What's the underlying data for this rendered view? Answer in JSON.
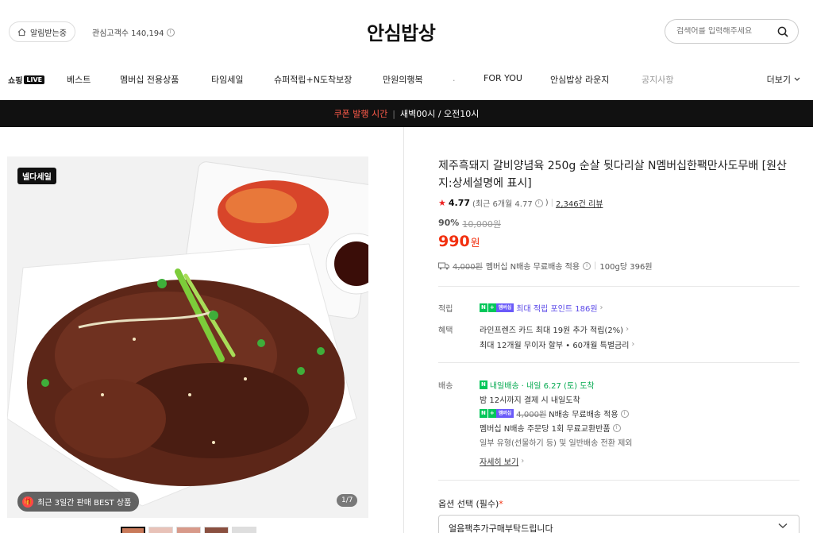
{
  "header": {
    "alarm_label": "알림받는중",
    "interest_label": "관심고객수 140,194",
    "info_glyph": "i",
    "logo": "안심밥상",
    "search_placeholder": "검색어를 입력해주세요"
  },
  "nav": {
    "live_logo_text": "쇼핑",
    "live_tag": "LIVE",
    "items": [
      "베스트",
      "멤버십 전용상품",
      "타임세일",
      "슈퍼적립+N도착보장",
      "만원의행복",
      ".",
      "FOR YOU",
      "안심밥상 라운지",
      "공지사항"
    ],
    "more_label": "더보기"
  },
  "coupon_bar": {
    "label": "쿠폰 발행 시간",
    "sep": "|",
    "time": "새벽00시 / 오전10시"
  },
  "gallery": {
    "badge": "넬다세일",
    "best_badge": "최근 3일간 판매 BEST 상품",
    "pager": "1/7",
    "thumb_count": 5
  },
  "product": {
    "title": "제주흑돼지 갈비양념육 250g 순살 뒷다리살 N멤버십한팩만사도무배 [원산지:상세설명에 표시]",
    "rating": {
      "star": "★",
      "score": "4.77",
      "recent": "(최근 6개월 4.77",
      "recent_close": ")",
      "sep": "|",
      "reviews": "2,346건 리뷰"
    },
    "discount_pct": "90%",
    "original_price": "10,000원",
    "price": "990",
    "price_unit": "원",
    "shipping": {
      "strike": "4,000원",
      "text": "멤버십 N배송 무료배송 적용",
      "sep": "|",
      "unit_price": "100g당 396원"
    }
  },
  "benefits": {
    "points_label": "적립",
    "points_text": "최대 적립 포인트 186원",
    "perks_label": "혜택",
    "perk1": "라인프렌즈 카드 최대 19원 추가 적립(2%)",
    "perk2": "최대 12개월 무이자 할부 • 60개월 특별금리"
  },
  "delivery": {
    "label": "배송",
    "badge": "내일배송",
    "eta": "· 내일 6.27 (토) 도착",
    "line1": "밤 12시까지 결제 시 내일도착",
    "strike": "4,000원",
    "line2": "N배송 무료배송 적용",
    "line3": "멤버십 N배송 주문당 1회 무료교환반품",
    "line4": "일부 유형(선물하기 등) 및 일반배송 전환 제외",
    "more_link": "자세히 보기"
  },
  "badges": {
    "n": "N",
    "plus": "+",
    "membership": "멤버십"
  },
  "options": {
    "label": "옵션 선택 (필수)",
    "required_mark": "*",
    "selected": "얼음팩추가구매부탁드립니다"
  },
  "colors": {
    "price_red": "#f2300f",
    "npay_green": "#03c75a",
    "membership_purple": "#6a5af9",
    "coupon_bar_bg": "#111111"
  }
}
